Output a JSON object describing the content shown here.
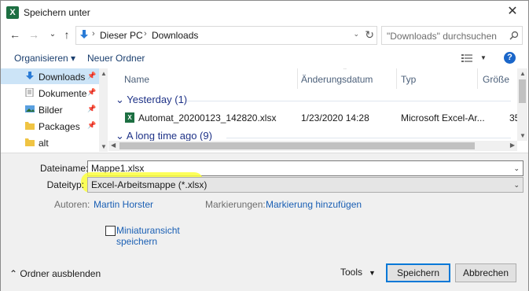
{
  "window": {
    "title": "Speichern unter",
    "app_icon": "X",
    "close": "✕"
  },
  "nav": {
    "back": "←",
    "forward": "→",
    "recent": "⌄",
    "up": "↑",
    "breadcrumb": [
      "Dieser PC",
      "Downloads"
    ],
    "search_placeholder": "\"Downloads\" durchsuchen"
  },
  "toolbar": {
    "organize": "Organisieren ▾",
    "new_folder": "Neuer Ordner",
    "help": "?"
  },
  "sidebar": [
    {
      "label": "Downloads",
      "icon": "download-folder-icon",
      "pinned": true,
      "selected": true
    },
    {
      "label": "Dokumente",
      "icon": "documents-folder-icon",
      "pinned": true
    },
    {
      "label": "Bilder",
      "icon": "pictures-folder-icon",
      "pinned": true
    },
    {
      "label": "Packages",
      "icon": "folder-icon",
      "pinned": true
    },
    {
      "label": "alt",
      "icon": "folder-icon",
      "pinned": false
    }
  ],
  "columns": [
    "Name",
    "Änderungsdatum",
    "Typ",
    "Größe"
  ],
  "groups": [
    {
      "label": "Yesterday (1)"
    },
    {
      "label": "A long time ago (9)"
    }
  ],
  "files": [
    {
      "name": "Automat_20200123_142820.xlsx",
      "date": "1/23/2020 14:28",
      "type": "Microsoft Excel-Ar...",
      "size": "35"
    }
  ],
  "form": {
    "filename_label": "Dateiname:",
    "filename_value": "Mappe1.xlsx",
    "filetype_label": "Dateityp:",
    "filetype_value": "Excel-Arbeitsmappe (*.xlsx)",
    "authors_label": "Autoren:",
    "authors_value": "Martin Horster",
    "tags_label": "Markierungen:",
    "tags_value": "Markierung hinzufügen",
    "thumbnail_label_1": "Miniaturansicht",
    "thumbnail_label_2": "speichern",
    "thumbnail_checked": false
  },
  "footer": {
    "hide_folders": "Ordner ausblenden",
    "tools": "Tools",
    "save": "Speichern",
    "cancel": "Abbrechen"
  },
  "colors": {
    "highlight": "#fbff3d",
    "accent": "#0078d7",
    "link": "#1a5fb4",
    "excel_green": "#1d6f42"
  }
}
